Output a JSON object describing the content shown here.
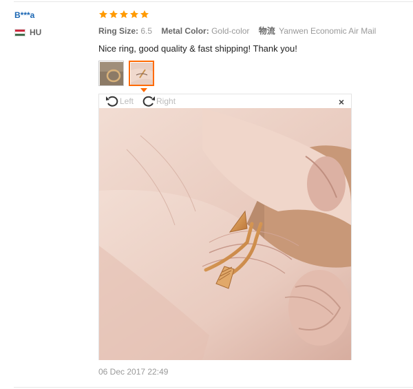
{
  "review": {
    "username": "B***a",
    "country": "HU",
    "rating": 5,
    "meta": {
      "ring_size_label": "Ring Size:",
      "ring_size_value": "6.5",
      "metal_color_label": "Metal Color:",
      "metal_color_value": "Gold-color",
      "shipping_label": "物流",
      "shipping_value": "Yanwen Economic Air Mail"
    },
    "comment": "Nice ring, good quality & fast shipping! Thank you!",
    "date": "06 Dec 2017 22:49"
  },
  "viewer": {
    "rotate_left": "Left",
    "rotate_right": "Right",
    "close": "×"
  },
  "colors": {
    "star": "#ff9a00",
    "username": "#1a66b3",
    "thumb_active": "#ff6a00"
  }
}
